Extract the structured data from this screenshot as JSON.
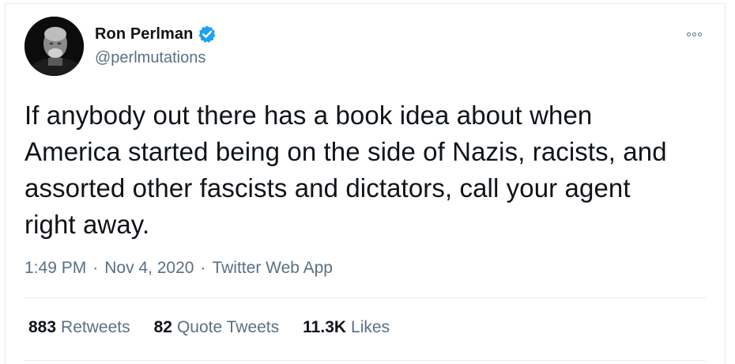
{
  "author": {
    "display_name": "Ron Perlman",
    "handle": "@perlmutations",
    "verified_icon": "verified-badge-icon",
    "avatar_icon": "avatar-photo"
  },
  "tweet": {
    "text": "If anybody out there has a book idea about when\nAmerica started being on the side of Nazis, racists, and\nassorted other fascists and dictators, call your agent\nright away."
  },
  "meta": {
    "time": "1:49 PM",
    "separator": "·",
    "date": "Nov 4, 2020",
    "source": "Twitter Web App"
  },
  "stats": {
    "retweets_count": "883",
    "retweets_label": "Retweets",
    "quotes_count": "82",
    "quotes_label": "Quote Tweets",
    "likes_count": "11.3K",
    "likes_label": "Likes"
  },
  "colors": {
    "text_primary": "#0f1419",
    "text_secondary": "#5b7083",
    "verified_blue": "#1da1f2",
    "divider": "#e6ecf0"
  },
  "more_icon": "more-options-icon"
}
